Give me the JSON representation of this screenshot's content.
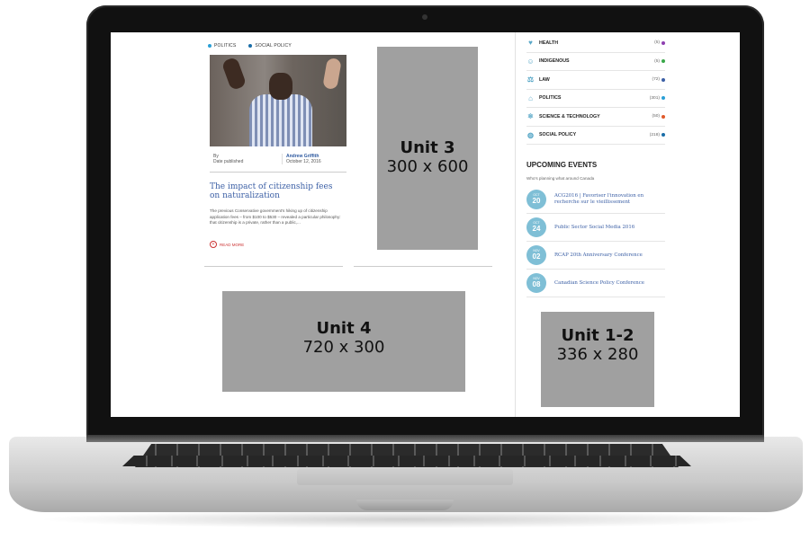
{
  "article": {
    "tags": [
      {
        "label": "POLITICS",
        "color": "#2a9fd6"
      },
      {
        "label": "SOCIAL POLICY",
        "color": "#1a6ea8"
      }
    ],
    "by_label": "By",
    "date_label": "Date published",
    "author": "Andrew Griffith",
    "date": "October 12, 2016",
    "title": "The impact of citizenship fees on naturalization",
    "excerpt": "The previous Conservative government's hiking up of citizenship application fees – from $100 to $530 – revealed a particular philosophy: that citizenship is a private, rather than a public,...",
    "read_more": "READ MORE"
  },
  "ads": {
    "unit3": {
      "name": "Unit 3",
      "size": "300 x 600"
    },
    "unit4": {
      "name": "Unit 4",
      "size": "720 x 300"
    },
    "unit12": {
      "name": "Unit 1-2",
      "size": "336 x 280"
    }
  },
  "categories": [
    {
      "label": "HEALTH",
      "count": "(5)",
      "color": "#8e3fb0",
      "icon": "heart-icon"
    },
    {
      "label": "INDIGENOUS",
      "count": "(5)",
      "color": "#3aa84a",
      "icon": "person-icon"
    },
    {
      "label": "LAW",
      "count": "(72)",
      "color": "#3b5fa5",
      "icon": "scales-icon"
    },
    {
      "label": "POLITICS",
      "count": "(301)",
      "color": "#2a9fd6",
      "icon": "building-icon"
    },
    {
      "label": "SCIENCE & TECHNOLOGY",
      "count": "(50)",
      "color": "#e05a2a",
      "icon": "atom-icon"
    },
    {
      "label": "SOCIAL POLICY",
      "count": "(218)",
      "color": "#1a6ea8",
      "icon": "globe-icon"
    }
  ],
  "events": {
    "title": "UPCOMING EVENTS",
    "subtitle": "Who's planning what around Canada",
    "items": [
      {
        "month": "OCT",
        "day": "20",
        "title": "ACG2016 | Favoriser l'innovation en recherche sur le vieillissement"
      },
      {
        "month": "OCT",
        "day": "24",
        "title": "Public Sector Social Media 2016"
      },
      {
        "month": "NOV",
        "day": "02",
        "title": "RCAP 20th Anniversary Conference"
      },
      {
        "month": "NOV",
        "day": "08",
        "title": "Canadian Science Policy Conference"
      }
    ]
  }
}
